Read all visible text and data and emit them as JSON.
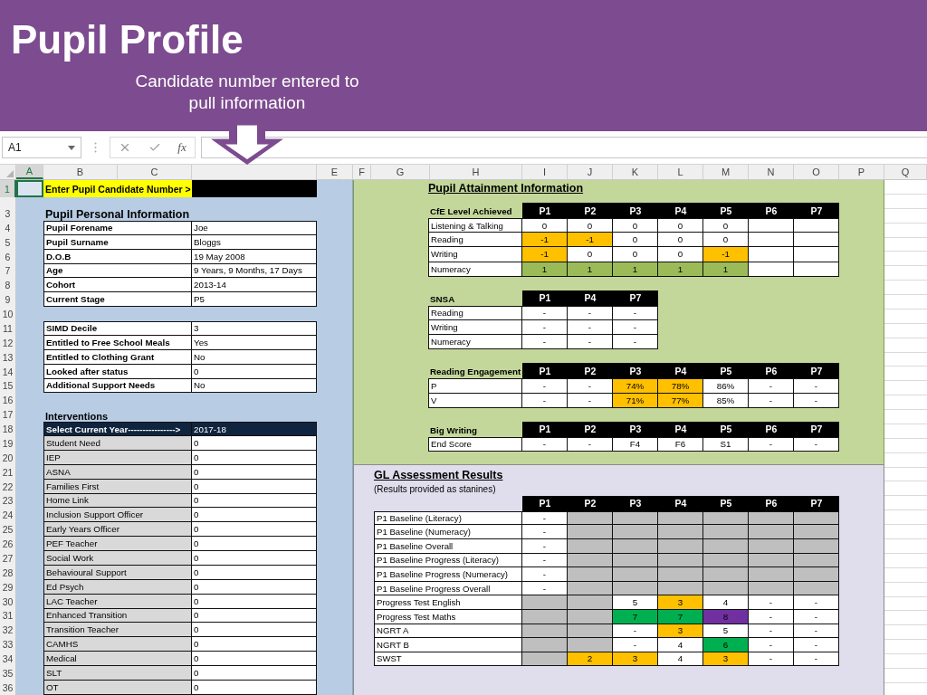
{
  "banner": {
    "title": "Pupil Profile",
    "subtitle": "Candidate number entered to pull information"
  },
  "formula_bar": {
    "name_box": "A1",
    "function_label": "fx"
  },
  "columns": [
    {
      "label": "A",
      "selected": true
    },
    {
      "label": "B",
      "selected": false
    },
    {
      "label": "C",
      "selected": false
    },
    {
      "selected": false
    },
    {
      "label": "E",
      "selected": false
    },
    {
      "label": "F",
      "selected": false
    },
    {
      "label": "G",
      "selected": false
    },
    {
      "label": "H",
      "selected": false
    },
    {
      "label": "I",
      "selected": false
    },
    {
      "label": "J",
      "selected": false
    },
    {
      "label": "K",
      "selected": false
    },
    {
      "label": "L",
      "selected": false
    },
    {
      "label": "M",
      "selected": false
    },
    {
      "label": "N",
      "selected": false
    },
    {
      "label": "O",
      "selected": false
    },
    {
      "label": "P",
      "selected": false
    },
    {
      "label": "Q",
      "selected": false
    }
  ],
  "rows": [
    {
      "label": "1",
      "selected": true
    },
    {
      "label": "3",
      "selected": false
    },
    {
      "label": "4",
      "selected": false
    },
    {
      "label": "5",
      "selected": false
    },
    {
      "label": "6",
      "selected": false
    },
    {
      "label": "7",
      "selected": false
    },
    {
      "label": "8",
      "selected": false
    },
    {
      "label": "9",
      "selected": false
    },
    {
      "label": "10",
      "selected": false
    },
    {
      "label": "11",
      "selected": false
    },
    {
      "label": "12",
      "selected": false
    },
    {
      "label": "13",
      "selected": false
    },
    {
      "label": "14",
      "selected": false
    },
    {
      "label": "15",
      "selected": false
    },
    {
      "label": "16",
      "selected": false
    },
    {
      "label": "17",
      "selected": false
    },
    {
      "label": "18",
      "selected": false
    },
    {
      "label": "19",
      "selected": false
    },
    {
      "label": "20",
      "selected": false
    },
    {
      "label": "21",
      "selected": false
    },
    {
      "label": "22",
      "selected": false
    },
    {
      "label": "23",
      "selected": false
    },
    {
      "label": "24",
      "selected": false
    },
    {
      "label": "25",
      "selected": false
    },
    {
      "label": "26",
      "selected": false
    },
    {
      "label": "27",
      "selected": false
    },
    {
      "label": "28",
      "selected": false
    },
    {
      "label": "29",
      "selected": false
    },
    {
      "label": "30",
      "selected": false
    },
    {
      "label": "31",
      "selected": false
    },
    {
      "label": "32",
      "selected": false
    },
    {
      "label": "33",
      "selected": false
    },
    {
      "label": "34",
      "selected": false
    },
    {
      "label": "35",
      "selected": false
    },
    {
      "label": "36",
      "selected": false
    }
  ],
  "candidate_prompt": {
    "label": "Enter Pupil Candidate Number >"
  },
  "personal_information": {
    "title": "Pupil Personal Information",
    "rows": [
      {
        "label": "Pupil Forename",
        "value": "Joe"
      },
      {
        "label": "Pupil Surname",
        "value": "Bloggs"
      },
      {
        "label": "D.O.B",
        "value": "19 May 2008"
      },
      {
        "label": "Age",
        "value": "9 Years, 9 Months, 17 Days"
      },
      {
        "label": "Cohort",
        "value": "2013-14"
      },
      {
        "label": "Current Stage",
        "value": "P5"
      }
    ]
  },
  "additional_information": {
    "rows": [
      {
        "label": "SIMD Decile",
        "value": "3"
      },
      {
        "label": "Entitled to Free School Meals",
        "value": "Yes"
      },
      {
        "label": "Entitled to Clothing Grant",
        "value": "No"
      },
      {
        "label": "Looked after status",
        "value": "0"
      },
      {
        "label": "Additional Support Needs",
        "value": "No"
      }
    ]
  },
  "interventions": {
    "title": "Interventions",
    "header": {
      "label": "Select Current Year---------------->",
      "value": "2017-18"
    },
    "rows": [
      {
        "label": "Student Need",
        "value": "0"
      },
      {
        "label": "IEP",
        "value": "0"
      },
      {
        "label": "ASNA",
        "value": "0"
      },
      {
        "label": "Families First",
        "value": "0"
      },
      {
        "label": "Home Link",
        "value": "0"
      },
      {
        "label": "Inclusion Support Officer",
        "value": "0"
      },
      {
        "label": "Early Years Officer",
        "value": "0"
      },
      {
        "label": "PEF Teacher",
        "value": "0"
      },
      {
        "label": "Social Work",
        "value": "0"
      },
      {
        "label": "Behavioural Support",
        "value": "0"
      },
      {
        "label": "Ed Psych",
        "value": "0"
      },
      {
        "label": "LAC Teacher",
        "value": "0"
      },
      {
        "label": "Enhanced Transition",
        "value": "0"
      },
      {
        "label": "Transition Teacher",
        "value": "0"
      },
      {
        "label": "CAMHS",
        "value": "0"
      },
      {
        "label": "Medical",
        "value": "0"
      },
      {
        "label": "SLT",
        "value": "0"
      },
      {
        "label": "OT",
        "value": "0"
      }
    ]
  },
  "attainment": {
    "title": "Pupil Attainment Information",
    "tables": [
      {
        "title": "CfE Level Achieved",
        "columns": [
          "P1",
          "P2",
          "P3",
          "P4",
          "P5",
          "P6",
          "P7"
        ],
        "rows": [
          {
            "label": "Listening & Talking",
            "cells": [
              {
                "text": "0"
              },
              {
                "text": "0"
              },
              {
                "text": "0"
              },
              {
                "text": "0"
              },
              {
                "text": "0"
              },
              {},
              {}
            ]
          },
          {
            "label": "Reading",
            "cells": [
              {
                "text": "-1",
                "color": "#ffc000"
              },
              {
                "text": "-1",
                "color": "#ffc000"
              },
              {
                "text": "0"
              },
              {
                "text": "0"
              },
              {
                "text": "0"
              },
              {},
              {}
            ]
          },
          {
            "label": "Writing",
            "cells": [
              {
                "text": "-1",
                "color": "#ffc000"
              },
              {
                "text": "0"
              },
              {
                "text": "0"
              },
              {
                "text": "0"
              },
              {
                "text": "-1",
                "color": "#ffc000"
              },
              {},
              {}
            ]
          },
          {
            "label": "Numeracy",
            "cells": [
              {
                "text": "1",
                "color": "#9bbb59"
              },
              {
                "text": "1",
                "color": "#9bbb59"
              },
              {
                "text": "1",
                "color": "#9bbb59"
              },
              {
                "text": "1",
                "color": "#9bbb59"
              },
              {
                "text": "1",
                "color": "#9bbb59"
              },
              {},
              {}
            ]
          }
        ]
      },
      {
        "title": "SNSA",
        "columns": [
          "P1",
          "P4",
          "P7"
        ],
        "rows": [
          {
            "label": "Reading",
            "cells": [
              {
                "text": "-"
              },
              {
                "text": "-"
              },
              {
                "text": "-"
              }
            ]
          },
          {
            "label": "Writing",
            "cells": [
              {
                "text": "-"
              },
              {
                "text": "-"
              },
              {
                "text": "-"
              }
            ]
          },
          {
            "label": "Numeracy",
            "cells": [
              {
                "text": "-"
              },
              {
                "text": "-"
              },
              {
                "text": "-"
              }
            ]
          }
        ]
      },
      {
        "title": "Reading Engagement",
        "columns": [
          "P1",
          "P2",
          "P3",
          "P4",
          "P5",
          "P6",
          "P7"
        ],
        "rows": [
          {
            "label": "P",
            "cells": [
              {
                "text": "-"
              },
              {
                "text": "-"
              },
              {
                "text": "74%",
                "color": "#ffc000"
              },
              {
                "text": "78%",
                "color": "#ffc000"
              },
              {
                "text": "86%"
              },
              {
                "text": "-"
              },
              {
                "text": "-"
              }
            ]
          },
          {
            "label": "V",
            "cells": [
              {
                "text": "-"
              },
              {
                "text": "-"
              },
              {
                "text": "71%",
                "color": "#ffc000"
              },
              {
                "text": "77%",
                "color": "#ffc000"
              },
              {
                "text": "85%"
              },
              {
                "text": "-"
              },
              {
                "text": "-"
              }
            ]
          }
        ]
      },
      {
        "title": "Big Writing",
        "columns": [
          "P1",
          "P2",
          "P3",
          "P4",
          "P5",
          "P6",
          "P7"
        ],
        "rows": [
          {
            "label": "End Score",
            "cells": [
              {
                "text": "-"
              },
              {
                "text": "-"
              },
              {
                "text": "F4"
              },
              {
                "text": "F6"
              },
              {
                "text": "S1"
              },
              {
                "text": "-"
              },
              {
                "text": "-"
              }
            ]
          }
        ]
      }
    ]
  },
  "gl_assessment": {
    "title": "GL Assessment Results",
    "subtitle": "(Results provided as stanines)",
    "columns": [
      "P1",
      "P2",
      "P3",
      "P4",
      "P5",
      "P6",
      "P7"
    ],
    "rows": [
      {
        "label": "P1 Baseline (Literacy)",
        "cells": [
          {
            "text": "-"
          },
          {
            "color": "#bfbfbf"
          },
          {
            "color": "#bfbfbf"
          },
          {
            "color": "#bfbfbf"
          },
          {
            "color": "#bfbfbf"
          },
          {
            "color": "#bfbfbf"
          },
          {
            "color": "#bfbfbf"
          }
        ]
      },
      {
        "label": "P1 Baseline (Numeracy)",
        "cells": [
          {
            "text": "-"
          },
          {
            "color": "#bfbfbf"
          },
          {
            "color": "#bfbfbf"
          },
          {
            "color": "#bfbfbf"
          },
          {
            "color": "#bfbfbf"
          },
          {
            "color": "#bfbfbf"
          },
          {
            "color": "#bfbfbf"
          }
        ]
      },
      {
        "label": "P1 Baseline Overall",
        "cells": [
          {
            "text": "-"
          },
          {
            "color": "#bfbfbf"
          },
          {
            "color": "#bfbfbf"
          },
          {
            "color": "#bfbfbf"
          },
          {
            "color": "#bfbfbf"
          },
          {
            "color": "#bfbfbf"
          },
          {
            "color": "#bfbfbf"
          }
        ]
      },
      {
        "label": "P1 Baseline Progress (Literacy)",
        "cells": [
          {
            "text": "-"
          },
          {
            "color": "#bfbfbf"
          },
          {
            "color": "#bfbfbf"
          },
          {
            "color": "#bfbfbf"
          },
          {
            "color": "#bfbfbf"
          },
          {
            "color": "#bfbfbf"
          },
          {
            "color": "#bfbfbf"
          }
        ]
      },
      {
        "label": "P1 Baseline Progress (Numeracy)",
        "cells": [
          {
            "text": "-"
          },
          {
            "color": "#bfbfbf"
          },
          {
            "color": "#bfbfbf"
          },
          {
            "color": "#bfbfbf"
          },
          {
            "color": "#bfbfbf"
          },
          {
            "color": "#bfbfbf"
          },
          {
            "color": "#bfbfbf"
          }
        ]
      },
      {
        "label": "P1 Baseline Progress Overall",
        "cells": [
          {
            "text": "-"
          },
          {
            "color": "#bfbfbf"
          },
          {
            "color": "#bfbfbf"
          },
          {
            "color": "#bfbfbf"
          },
          {
            "color": "#bfbfbf"
          },
          {
            "color": "#bfbfbf"
          },
          {
            "color": "#bfbfbf"
          }
        ]
      },
      {
        "label": "Progress Test English",
        "cells": [
          {
            "color": "#bfbfbf"
          },
          {
            "color": "#bfbfbf"
          },
          {
            "text": "5"
          },
          {
            "text": "3",
            "color": "#ffc000"
          },
          {
            "text": "4"
          },
          {
            "text": "-"
          },
          {
            "text": "-"
          }
        ]
      },
      {
        "label": "Progress Test Maths",
        "cells": [
          {
            "color": "#bfbfbf"
          },
          {
            "color": "#bfbfbf"
          },
          {
            "text": "7",
            "color": "#00b050"
          },
          {
            "text": "7",
            "color": "#00b050"
          },
          {
            "text": "8",
            "color": "#7030a0"
          },
          {
            "text": "-"
          },
          {
            "text": "-"
          }
        ]
      },
      {
        "label": "NGRT A",
        "cells": [
          {
            "color": "#bfbfbf"
          },
          {
            "color": "#bfbfbf"
          },
          {
            "text": "-"
          },
          {
            "text": "3",
            "color": "#ffc000"
          },
          {
            "text": "5"
          },
          {
            "text": "-"
          },
          {
            "text": "-"
          }
        ]
      },
      {
        "label": "NGRT B",
        "cells": [
          {
            "color": "#bfbfbf"
          },
          {
            "color": "#bfbfbf"
          },
          {
            "text": "-"
          },
          {
            "text": "4"
          },
          {
            "text": "6",
            "color": "#00b050"
          },
          {
            "text": "-"
          },
          {
            "text": "-"
          }
        ]
      },
      {
        "label": "SWST",
        "cells": [
          {
            "color": "#bfbfbf"
          },
          {
            "text": "2",
            "color": "#ffc000"
          },
          {
            "text": "3",
            "color": "#ffc000"
          },
          {
            "text": "4"
          },
          {
            "text": "3",
            "color": "#ffc000"
          },
          {
            "text": "-"
          },
          {
            "text": "-"
          }
        ]
      }
    ]
  }
}
